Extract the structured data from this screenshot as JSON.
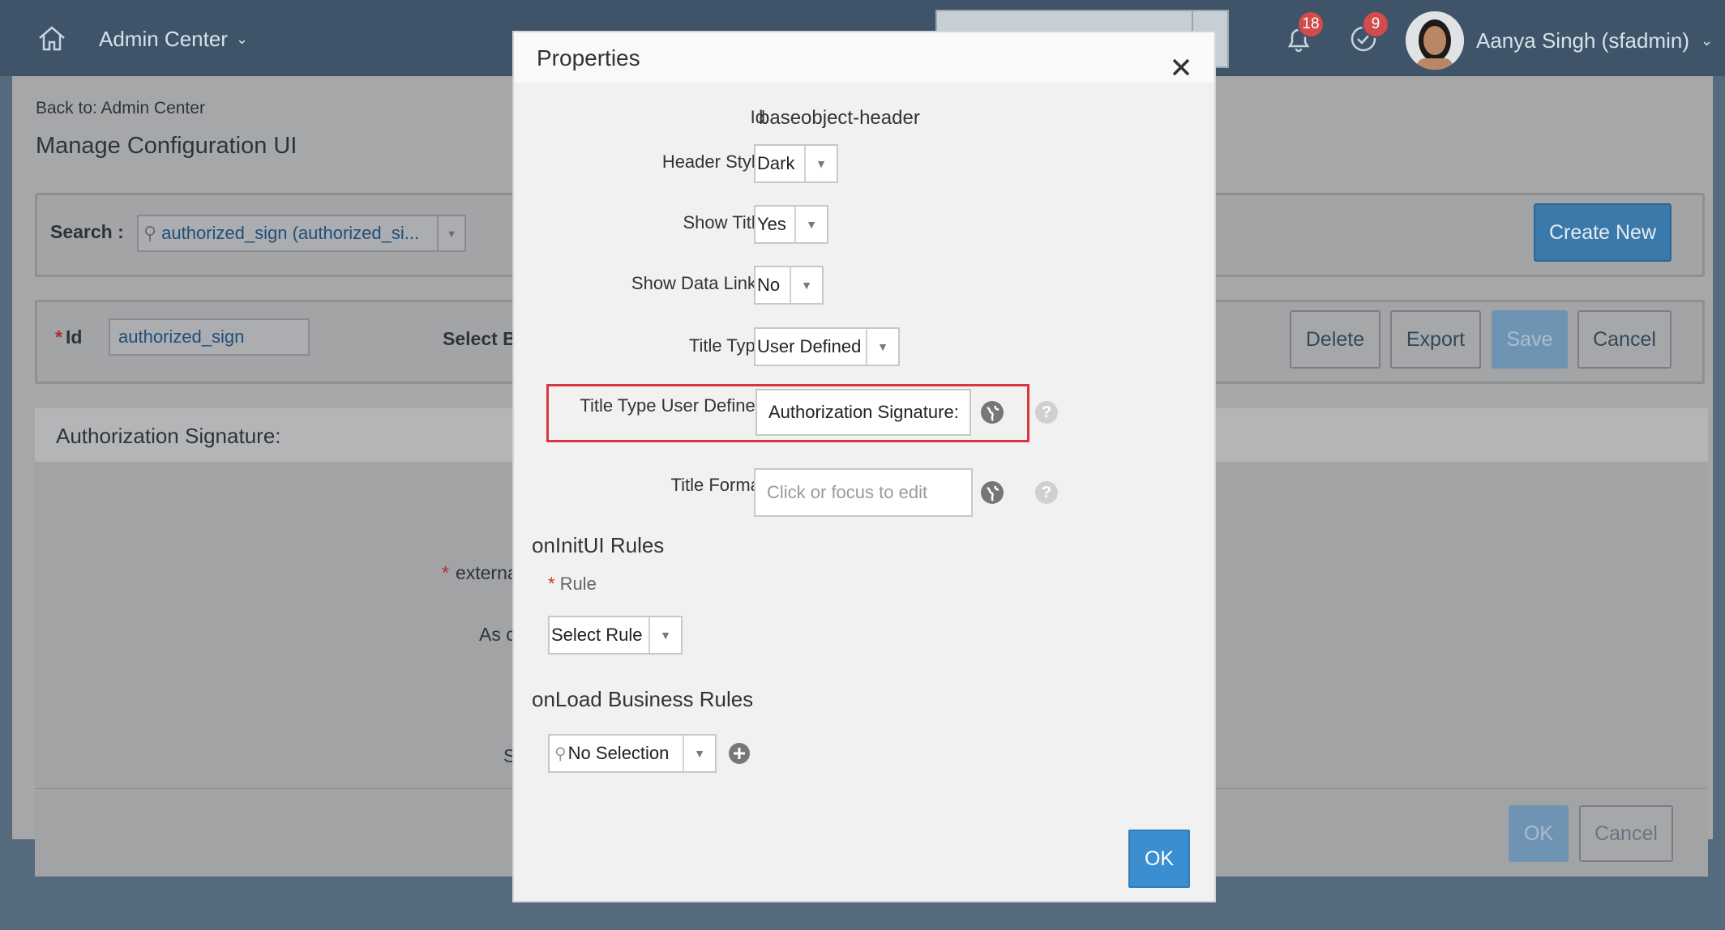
{
  "shell": {
    "home_icon": "home-icon",
    "app_title": "Admin Center",
    "user_name": "Aanya Singh (sfadmin)",
    "notifications_count": "18",
    "tasks_count": "9"
  },
  "page": {
    "back_link": "Back to: Admin Center",
    "title": "Manage Configuration UI",
    "search_label": "Search :",
    "search_value": "authorized_sign (authorized_si...",
    "create_new": "Create New",
    "id_required": "*",
    "id_label": "Id",
    "id_value": "authorized_sign",
    "select_base_partial": "Select Ba",
    "delete": "Delete",
    "export": "Export",
    "save": "Save",
    "cancel": "Cancel",
    "section_title": "Authorization Signature:",
    "field_external_partial": "externa",
    "field_as_partial": "As c",
    "field_s_partial": "S",
    "ok": "OK",
    "cancel2": "Cancel"
  },
  "dialog": {
    "title": "Properties",
    "close_icon": "close-icon",
    "id_label": "Id",
    "id_value": "baseobject-header",
    "header_style_label": "Header Style",
    "header_style_value": "Dark",
    "show_title_label": "Show Title",
    "show_title_value": "Yes",
    "show_data_links_label": "Show Data Links",
    "show_data_links_value": "No",
    "title_type_label": "Title Type",
    "title_type_value": "User Defined",
    "title_type_user_defined_label": "Title Type User Defined",
    "title_type_user_defined_value": "Authorization Signature:",
    "title_format_label": "Title Format",
    "title_format_placeholder": "Click or focus to edit",
    "oninit_heading": "onInitUI Rules",
    "rule_required": "*",
    "rule_label": "Rule",
    "rule_select_value": "Select Rule",
    "onload_heading": "onLoad Business Rules",
    "onload_select_value": "No Selection",
    "ok": "OK",
    "highlight_color": "#d9363e",
    "accent_color": "#3b8fd0"
  }
}
